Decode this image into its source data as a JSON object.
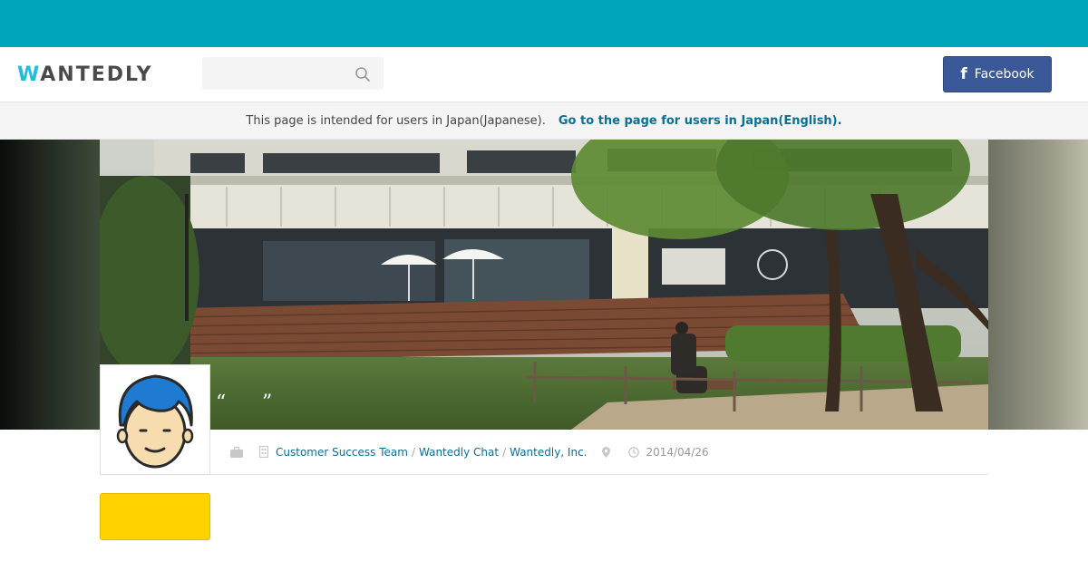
{
  "brand": {
    "logo_first": "W",
    "logo_rest": "ANTEDLY",
    "accent": "#00a4bb",
    "logo_color": "#21bddb"
  },
  "header": {
    "search_placeholder": "",
    "search_icon": "search-icon",
    "facebook_label": "Facebook",
    "facebook_color": "#3b5998"
  },
  "notice": {
    "text": "This page is intended for users in Japan(Japanese).",
    "link": "Go to the page for users in Japan(English)."
  },
  "profile": {
    "quote_open": "“",
    "quote_close": "”",
    "team": "Customer Success Team",
    "product": "Wantedly Chat",
    "company": "Wantedly, Inc.",
    "separator": "/",
    "date": "2014/04/26",
    "icons": [
      "briefcase-icon",
      "building-icon",
      "location-pin-icon",
      "clock-icon"
    ]
  },
  "action_button": {
    "label": "",
    "color": "#ffd200"
  }
}
